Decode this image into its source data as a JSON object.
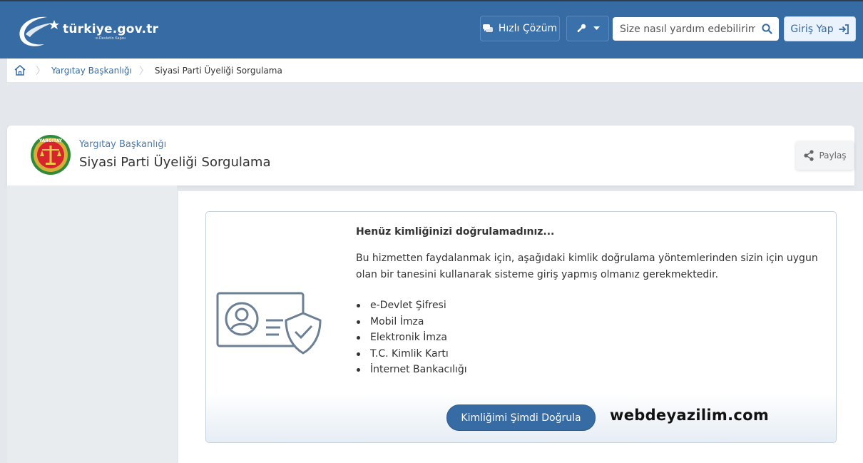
{
  "header": {
    "logo_text": "türkiye.gov.tr",
    "logo_subtitle": "e-Devletin Kapısı",
    "quick_solution_label": "Hızlı Çözüm",
    "search_placeholder": "Size nasıl yardım edebilirim?",
    "login_label": "Giriş Yap",
    "colors": {
      "bar": "#376ba3",
      "accent_light": "#eaf2fb"
    }
  },
  "breadcrumb": {
    "items": [
      "Yargıtay Başkanlığı",
      "Siyasi Parti Üyeliği Sorgulama"
    ]
  },
  "service": {
    "institution": "Yargıtay Başkanlığı",
    "title": "Siyasi Parti Üyeliği Sorgulama",
    "share_label": "Paylaş",
    "emblem_text": "YARGITAY"
  },
  "auth_notice": {
    "heading": "Henüz kimliğinizi doğrulamadınız...",
    "paragraph": "Bu hizmetten faydalanmak için, aşağıdaki kimlik doğrulama yöntemlerinden sizin için uygun olan bir tanesini kullanarak sisteme giriş yapmış olmanız gerekmektedir.",
    "methods": [
      "e-Devlet Şifresi",
      "Mobil İmza",
      "Elektronik İmza",
      "T.C. Kimlik Kartı",
      "İnternet Bankacılığı"
    ],
    "verify_button_label": "Kimliğimi Şimdi Doğrula"
  },
  "watermark": "webdeyazilim.com"
}
